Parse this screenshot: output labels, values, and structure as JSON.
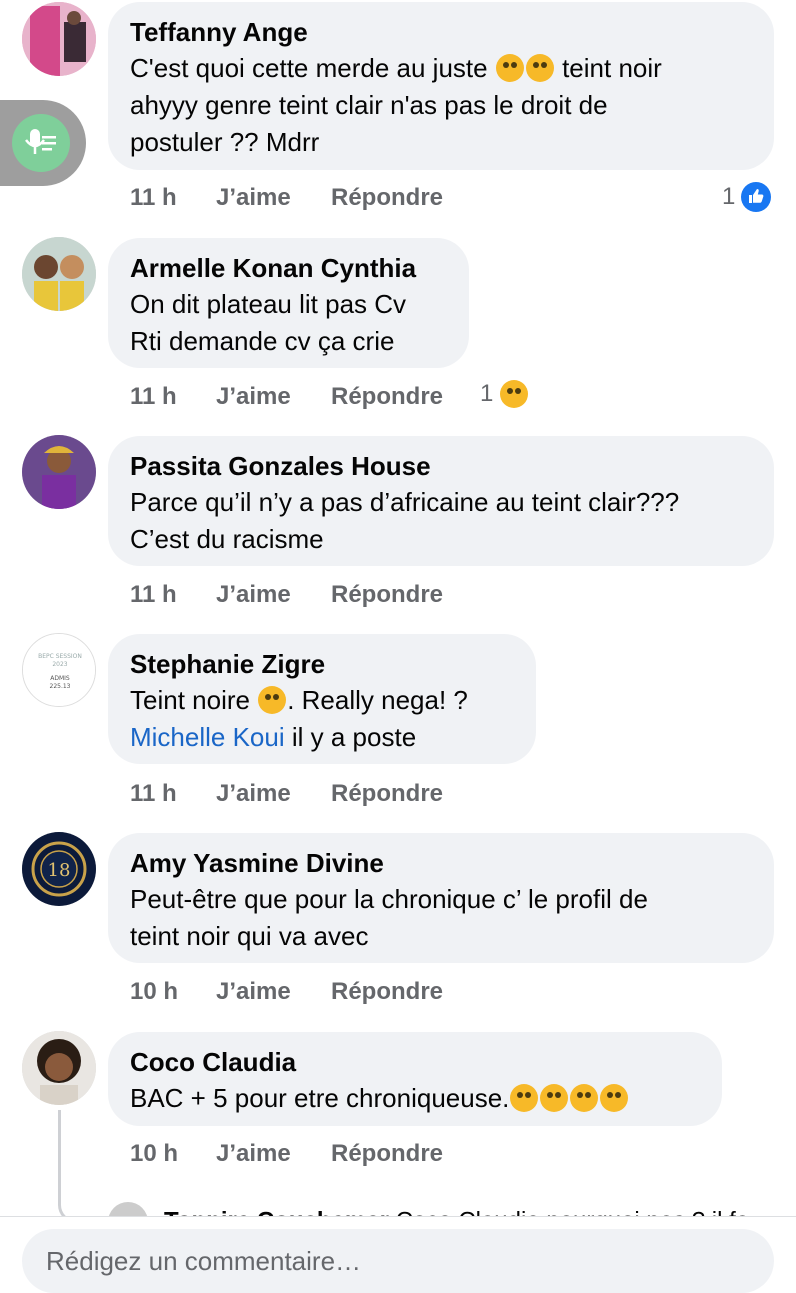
{
  "comments": [
    {
      "author": "Teffanny Ange",
      "lines": [
        "C'est quoi cette merde au juste",
        "ahyyy genre teint clair n'as pas le droit de",
        "postuler ?? Mdrr"
      ],
      "line1_suffix": "teint noir",
      "time": "11 h",
      "like": "J’aime",
      "reply": "Répondre",
      "reaction_count": "1",
      "reaction": "like-icon"
    },
    {
      "author": "Armelle Konan Cynthia",
      "lines": [
        "On dit plateau lit pas Cv",
        "Rti demande cv ça crie"
      ],
      "time": "11 h",
      "like": "J’aime",
      "reply": "Répondre",
      "reaction_count": "1",
      "reaction": "laugh-icon"
    },
    {
      "author": "Passita Gonzales House",
      "lines": [
        "Parce qu’il n’y a pas d’africaine au teint clair???",
        "C’est du racisme"
      ],
      "time": "11 h",
      "like": "J’aime",
      "reply": "Répondre"
    },
    {
      "author": "Stephanie Zigre",
      "line1": "Teint noire",
      "line1_suffix": ". Really nega! ?",
      "mention": "Michelle Koui",
      "line2_suffix": " il y a poste",
      "time": "11 h",
      "like": "J’aime",
      "reply": "Répondre",
      "avatar_text": [
        "BEPC SESSION",
        "2023",
        "ADMIS",
        "225.13"
      ]
    },
    {
      "author": "Amy Yasmine Divine",
      "lines": [
        "Peut-être que pour la chronique c’ le profil de",
        "teint noir qui va avec"
      ],
      "time": "10 h",
      "like": "J’aime",
      "reply": "Répondre",
      "avatar_text": [
        "18"
      ]
    },
    {
      "author": "Coco Claudia",
      "lines": [
        "BAC + 5 pour etre chroniqueuse."
      ],
      "time": "10 h",
      "like": "J’aime",
      "reply": "Répondre"
    }
  ],
  "reply_peek": {
    "author": "Tonnire Couchemar",
    "text": "Coco Claudia pourquoi pas ? il fa"
  },
  "composer": {
    "placeholder": "Rédigez un commentaire…"
  },
  "colors": {
    "bubble": "#f0f2f5",
    "secondary_text": "#65676b",
    "mention": "#1a66c7",
    "like_blue": "#1877f2"
  }
}
